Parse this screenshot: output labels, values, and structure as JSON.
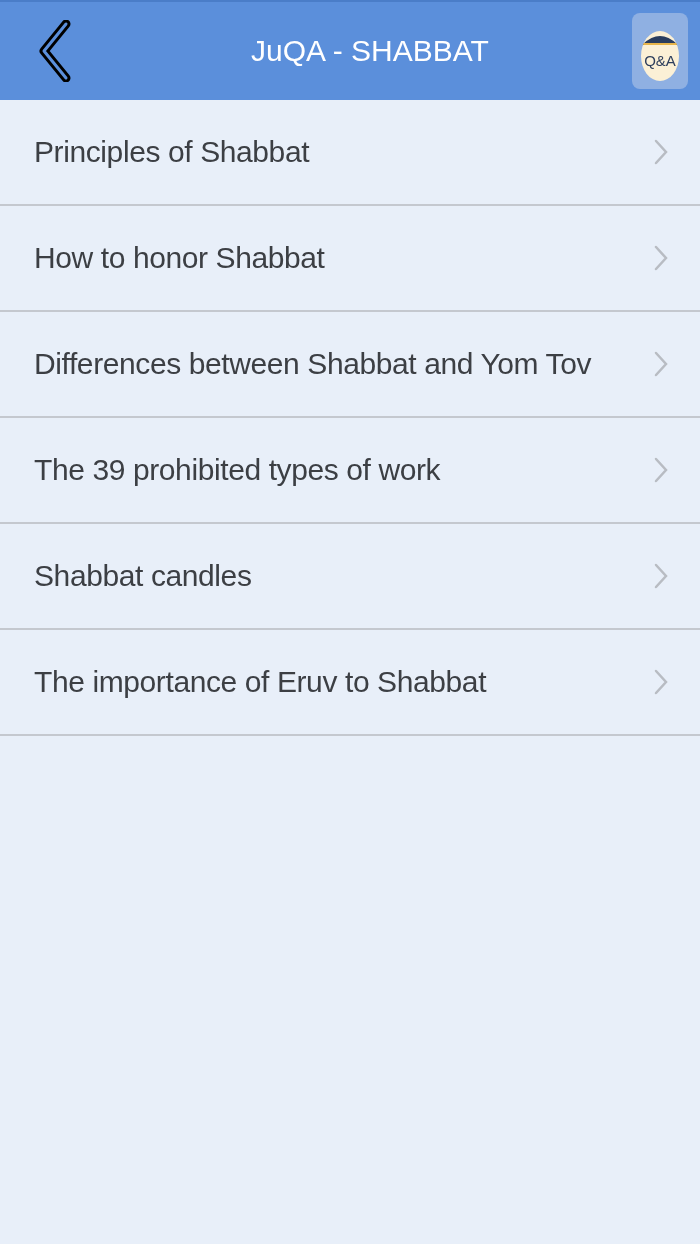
{
  "header": {
    "title": "JuQA - SHABBAT",
    "logo_text": "Q&A"
  },
  "items": [
    {
      "label": "Principles of Shabbat"
    },
    {
      "label": "How to honor Shabbat"
    },
    {
      "label": "Differences between Shabbat and Yom Tov"
    },
    {
      "label": "The 39 prohibited types of work"
    },
    {
      "label": "Shabbat candles"
    },
    {
      "label": "The importance of Eruv to Shabbat"
    }
  ]
}
